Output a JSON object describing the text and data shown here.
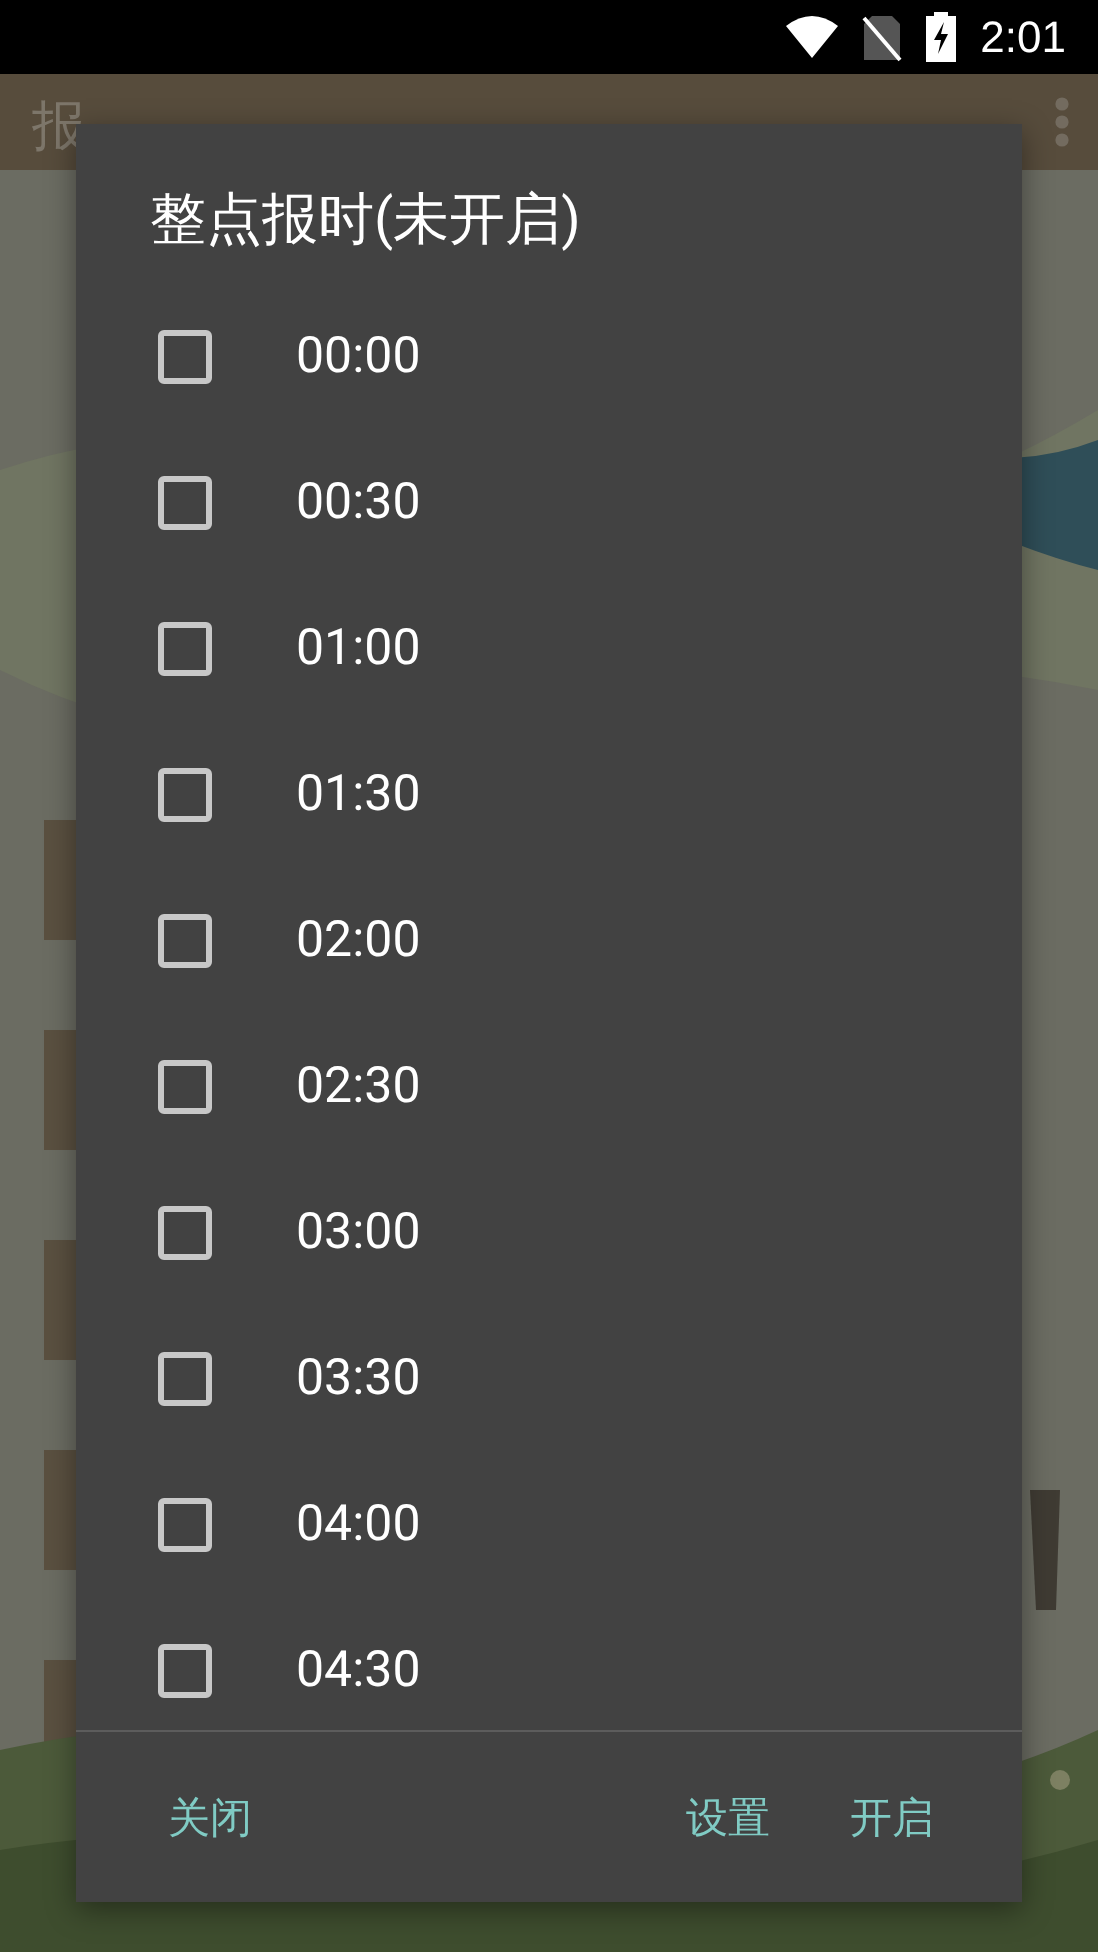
{
  "status_bar": {
    "time": "2:01"
  },
  "app_bar": {
    "title": "报"
  },
  "dialog": {
    "title": "整点报时(未开启)",
    "items": [
      {
        "label": "00:00",
        "checked": false
      },
      {
        "label": "00:30",
        "checked": false
      },
      {
        "label": "01:00",
        "checked": false
      },
      {
        "label": "01:30",
        "checked": false
      },
      {
        "label": "02:00",
        "checked": false
      },
      {
        "label": "02:30",
        "checked": false
      },
      {
        "label": "03:00",
        "checked": false
      },
      {
        "label": "03:30",
        "checked": false
      },
      {
        "label": "04:00",
        "checked": false
      },
      {
        "label": "04:30",
        "checked": false
      }
    ],
    "left_buttons": [
      "关闭"
    ],
    "right_buttons": [
      "设置",
      "开启"
    ]
  }
}
